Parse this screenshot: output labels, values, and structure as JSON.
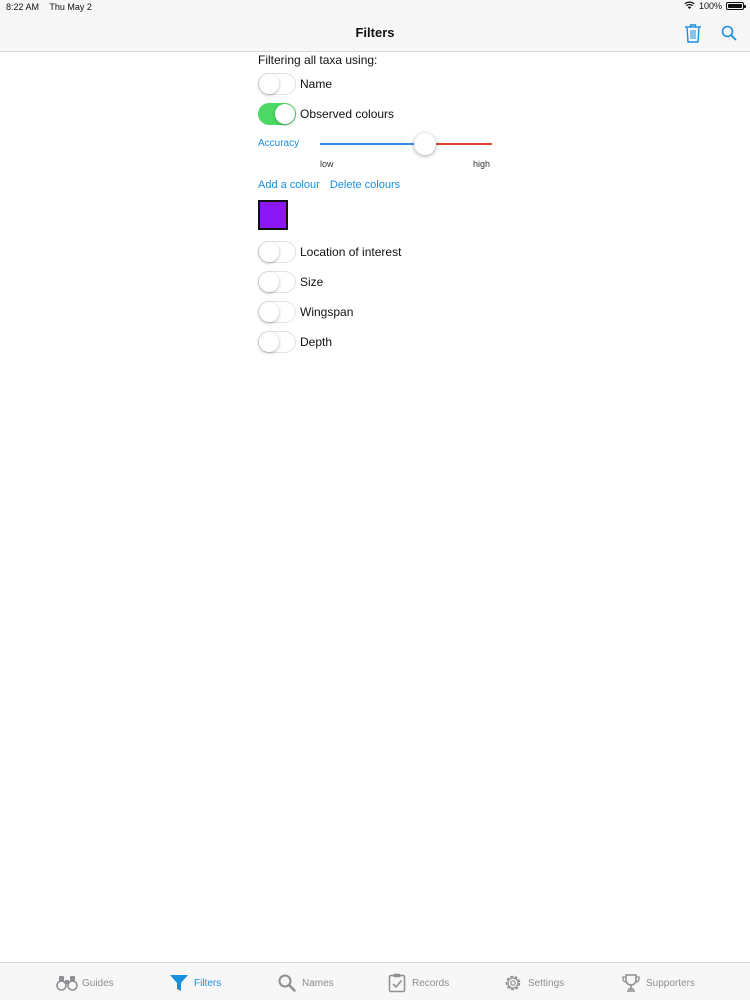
{
  "status": {
    "time": "8:22 AM",
    "date": "Thu May 2",
    "battery": "100%"
  },
  "nav": {
    "title": "Filters"
  },
  "filters": {
    "heading": "Filtering all taxa using:",
    "name": {
      "label": "Name",
      "on": false
    },
    "observed_colours": {
      "label": "Observed colours",
      "on": true
    },
    "accuracy": {
      "label": "Accuracy",
      "low_label": "low",
      "high_label": "high",
      "value": 0.61
    },
    "add_colour": "Add a colour",
    "delete_colours": "Delete colours",
    "selected_colour": "#8b17f5",
    "location": {
      "label": "Location of interest",
      "on": false
    },
    "size": {
      "label": "Size",
      "on": false
    },
    "wingspan": {
      "label": "Wingspan",
      "on": false
    },
    "depth": {
      "label": "Depth",
      "on": false
    }
  },
  "tabs": [
    {
      "label": "Guides",
      "icon": "binoculars-icon",
      "active": false
    },
    {
      "label": "Filters",
      "icon": "funnel-icon",
      "active": true
    },
    {
      "label": "Names",
      "icon": "search-icon",
      "active": false
    },
    {
      "label": "Records",
      "icon": "clipboard-check-icon",
      "active": false
    },
    {
      "label": "Settings",
      "icon": "gear-icon",
      "active": false
    },
    {
      "label": "Supporters",
      "icon": "trophy-icon",
      "active": false
    }
  ],
  "colors": {
    "accent": "#1a8fe0",
    "toggle_on": "#4cd964",
    "slider_min": "#2f8fe8",
    "slider_max": "#e8442e"
  }
}
